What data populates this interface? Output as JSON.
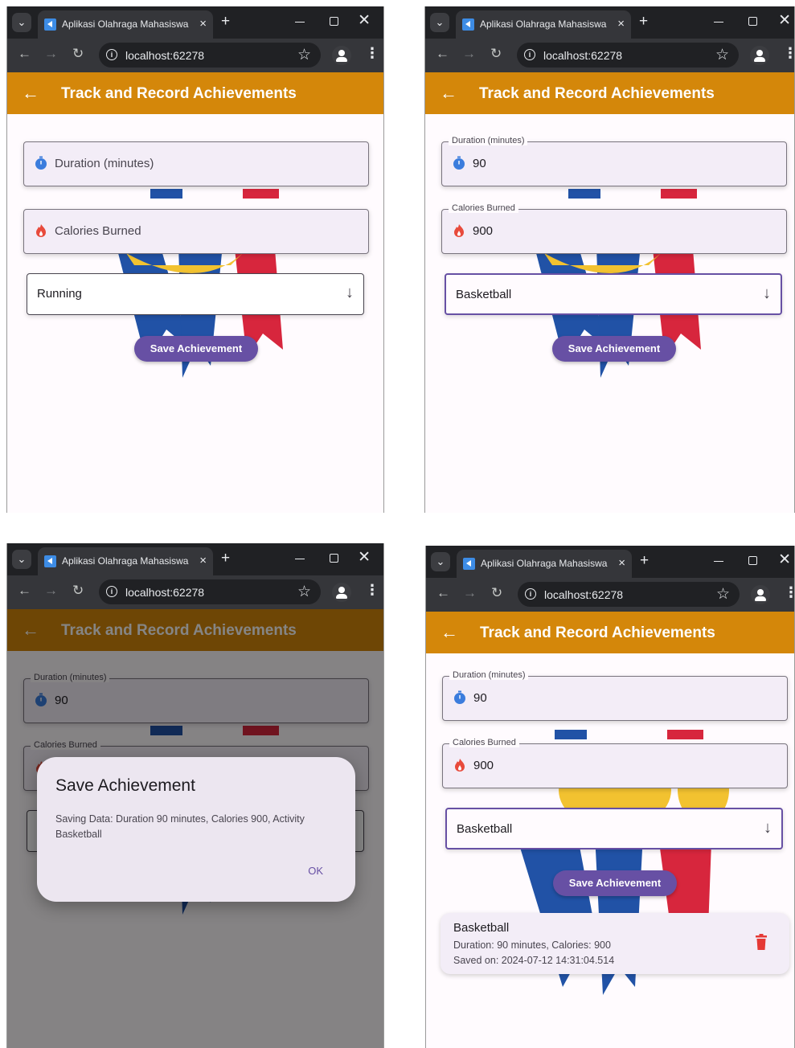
{
  "browser": {
    "tab_title": "Aplikasi Olahraga Mahasiswa",
    "tab_close": "×",
    "new_tab": "+",
    "url": "localhost:62278",
    "win_close": "✕",
    "back": "←",
    "forward": "→",
    "reload": "↻",
    "star": "☆",
    "menu": "⋮",
    "info": "i",
    "dropdown_glyph": "⌄"
  },
  "app": {
    "title": "Track and Record Achievements",
    "back_glyph": "←",
    "dropdown_arrow": "↓",
    "save_button": "Save Achievement"
  },
  "panels": [
    {
      "duration_label": "Duration (minutes)",
      "duration_value": "",
      "calories_label": "Calories Burned",
      "calories_value": "",
      "activity": "Running"
    },
    {
      "duration_label": "Duration (minutes)",
      "duration_value": "90",
      "calories_label": "Calories Burned",
      "calories_value": "900",
      "activity": "Basketball"
    },
    {
      "duration_label": "Duration (minutes)",
      "duration_value": "90",
      "calories_label": "Calories Burned",
      "calories_value": "",
      "activity": ""
    },
    {
      "duration_label": "Duration (minutes)",
      "duration_value": "90",
      "calories_label": "Calories Burned",
      "calories_value": "900",
      "activity": "Basketball"
    }
  ],
  "dialog": {
    "title": "Save Achievement",
    "body": "Saving Data: Duration 90 minutes, Calories 900, Activity Basketball",
    "ok": "OK"
  },
  "record": {
    "activity": "Basketball",
    "details": "Duration: 90 minutes, Calories: 900",
    "saved_on": "Saved on: 2024-07-12 14:31:04.514"
  },
  "colors": {
    "appbar": "#d4870a",
    "primary": "#6750a4",
    "duration_icon": "#3b7ddd",
    "calories_icon": "#e84b3c",
    "delete_icon": "#e53935"
  }
}
